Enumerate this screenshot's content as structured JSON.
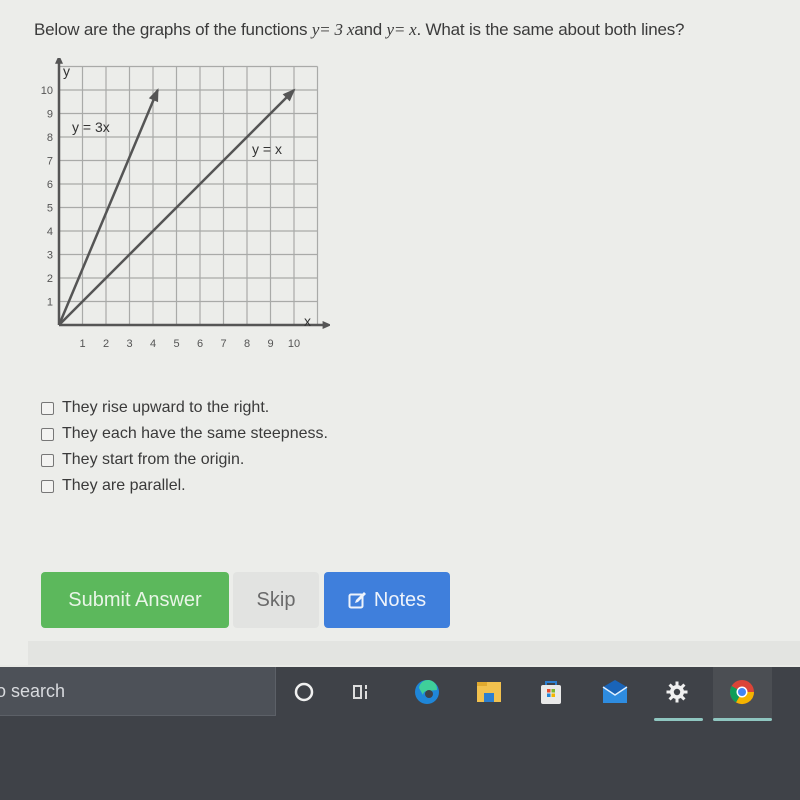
{
  "question": {
    "prefix": "Below are the graphs of the functions ",
    "eq1": "y= 3 x",
    "middle": "and ",
    "eq2": "y= x",
    "suffix": ". What is the same about both lines?"
  },
  "chart_data": {
    "type": "line",
    "title": "",
    "xlabel": "x",
    "ylabel": "y",
    "xlim": [
      0,
      11
    ],
    "ylim": [
      0,
      11
    ],
    "x_ticks": [
      "1",
      "2",
      "3",
      "4",
      "5",
      "6",
      "7",
      "8",
      "9",
      "10"
    ],
    "y_ticks": [
      "1",
      "2",
      "3",
      "4",
      "5",
      "6",
      "7",
      "8",
      "9",
      "10"
    ],
    "grid": true,
    "series": [
      {
        "name": "y = 3x",
        "label": "y = 3x",
        "points": [
          [
            0,
            0
          ],
          [
            4.2,
            10
          ]
        ]
      },
      {
        "name": "y = x",
        "label": "y = x",
        "points": [
          [
            0,
            0
          ],
          [
            10,
            10
          ]
        ]
      }
    ],
    "annotations": [
      "y = 3x",
      "y = x"
    ]
  },
  "choices": [
    {
      "label": "They rise upward to the right.",
      "checked": false
    },
    {
      "label": "They each have the same steepness.",
      "checked": false
    },
    {
      "label": "They start from the origin.",
      "checked": false
    },
    {
      "label": "They are parallel.",
      "checked": false
    }
  ],
  "buttons": {
    "submit": "Submit Answer",
    "skip": "Skip",
    "notes": "Notes",
    "notes_icon": "edit-icon"
  },
  "colors": {
    "submit": "#5cb85c",
    "notes": "#3f7fdc",
    "skip": "#e2e3e1"
  },
  "taskbar": {
    "search_text": "o search",
    "icons": [
      "cortana-icon",
      "task-view-icon",
      "edge-icon",
      "file-explorer-icon",
      "store-icon",
      "mail-icon",
      "settings-icon",
      "chrome-icon"
    ]
  }
}
